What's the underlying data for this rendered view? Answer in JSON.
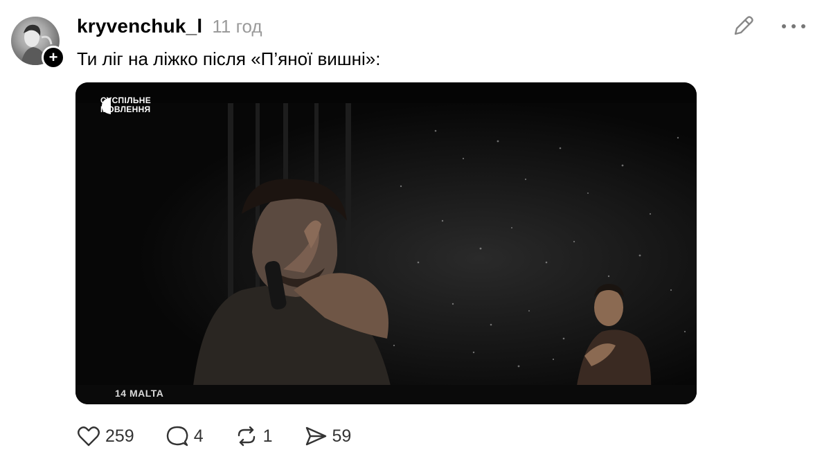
{
  "post": {
    "username": "kryvenchuk_l",
    "timestamp": "11 год",
    "text": "Ти ліг на ліжко після «П’яної вишні»:"
  },
  "media": {
    "broadcaster_logo": "СУСПІЛЬНЕ МОВЛЕННЯ",
    "caption": "14 MALTA"
  },
  "actions": {
    "likes": "259",
    "comments": "4",
    "reposts": "1",
    "shares": "59"
  },
  "icons": {
    "follow": "plus-icon",
    "edit": "pencil-icon",
    "more": "more-horizontal-icon",
    "like": "heart-icon",
    "comment": "comment-bubble-icon",
    "repost": "repost-icon",
    "share": "send-icon"
  },
  "colors": {
    "timestamp": "#9a9a9a",
    "icon": "#333333",
    "video_bg": "#050505"
  }
}
